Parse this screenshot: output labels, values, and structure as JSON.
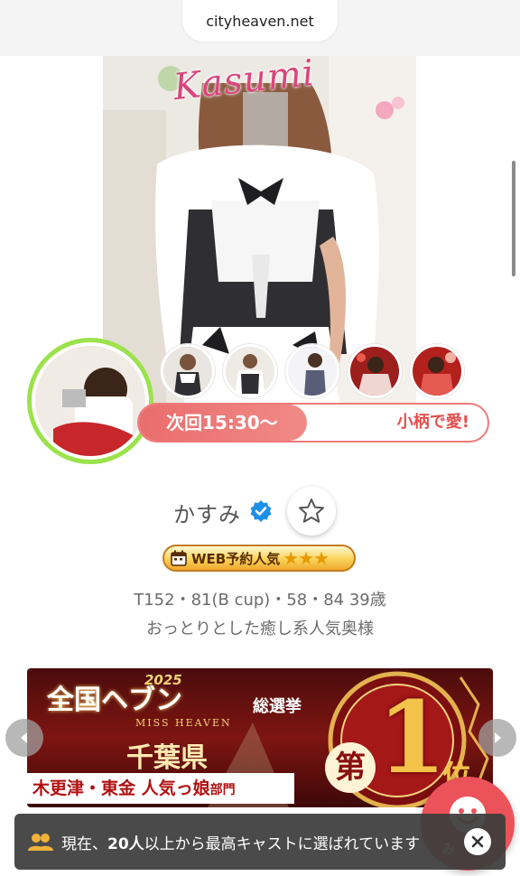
{
  "browser": {
    "url": "cityheaven.net"
  },
  "profile": {
    "photo_caption": "Kasumi",
    "next_slot": "次回15:30〜",
    "slot_message": "小柄で愛!",
    "name": "かすみ",
    "badge": {
      "label": "WEB予約人気",
      "stars": "★★★",
      "rating": 3
    },
    "spec": "T152・81(B cup)・58・84 39歳",
    "catchphrase": "おっとりとした癒し系人気奥様"
  },
  "banner": {
    "year": "2025",
    "title": "全国ヘブン",
    "subtitle": "MISS HEAVEN",
    "election": "総選挙",
    "prefecture": "千葉県",
    "area": "木更津・東金 人気っ娘",
    "area_suffix": "部門",
    "rank_prefix": "第",
    "rank_number": "1",
    "rank_suffix": "位"
  },
  "toast": {
    "text_before": "現在、",
    "count": "20人",
    "text_after": "以上から最高キャストに選ばれています"
  },
  "fab": {
    "label": "み"
  },
  "colors": {
    "accent": "#ec5259",
    "ring": "#9be24b",
    "slot": "#ea6d6d",
    "banner": "#7e1512"
  },
  "icons": [
    "verified-icon",
    "star-outline-icon",
    "calendar-icon",
    "people-icon",
    "close-icon",
    "smile-icon",
    "chevron-left-icon",
    "chevron-right-icon"
  ]
}
